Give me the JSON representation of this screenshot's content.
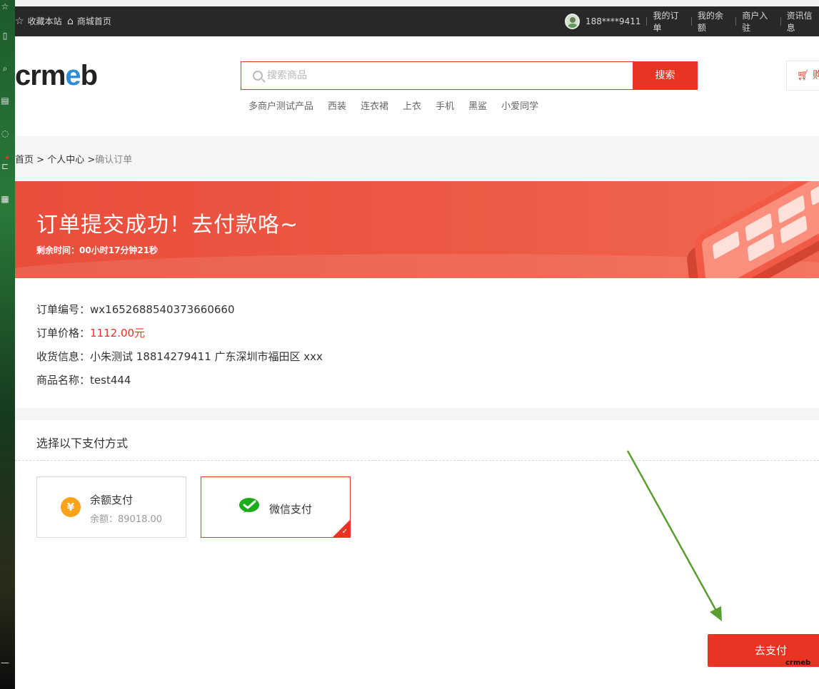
{
  "topbar": {
    "favorite": "收藏本站",
    "home": "商城首页",
    "phone": "188****9411",
    "my_orders": "我的订单",
    "my_balance": "我的余额",
    "merchant_join": "商户入驻",
    "news": "资讯信息"
  },
  "header": {
    "logo_pre": "crm",
    "logo_e": "e",
    "logo_post": "b",
    "search_placeholder": "搜索商品",
    "search_button": "搜索",
    "cart_label": "购",
    "hot_words": [
      "多商户测试产品",
      "西装",
      "连衣裙",
      "上衣",
      "手机",
      "黑鲨",
      "小爱同学"
    ]
  },
  "breadcrumb": {
    "home": "首页",
    "sep1": " > ",
    "center": "个人中心",
    "sep2": " >",
    "current": "确认订单"
  },
  "banner": {
    "title": "订单提交成功！去付款咯~",
    "countdown_label": "剩余时间：",
    "countdown": "00小时17分钟21秒"
  },
  "order": {
    "no_label": "订单编号：",
    "no": "wx1652688540373660660",
    "price_label": "订单价格：",
    "price": "1112.00元",
    "address_label": "收货信息：",
    "address": "小朱测试 18814279411 广东深圳市福田区 xxx",
    "product_label": "商品名称：",
    "product": "test444"
  },
  "payment": {
    "section_title": "选择以下支付方式",
    "balance_title": "余额支付",
    "balance_amount": "余额：89018.00",
    "coin_symbol": "¥",
    "wechat_title": "微信支付",
    "selected": "wechat",
    "pay_button": "去支付"
  },
  "watermark": "crmeb",
  "colors": {
    "accent": "#e93323",
    "topbar": "#282828",
    "arrow": "#5a9e32"
  }
}
